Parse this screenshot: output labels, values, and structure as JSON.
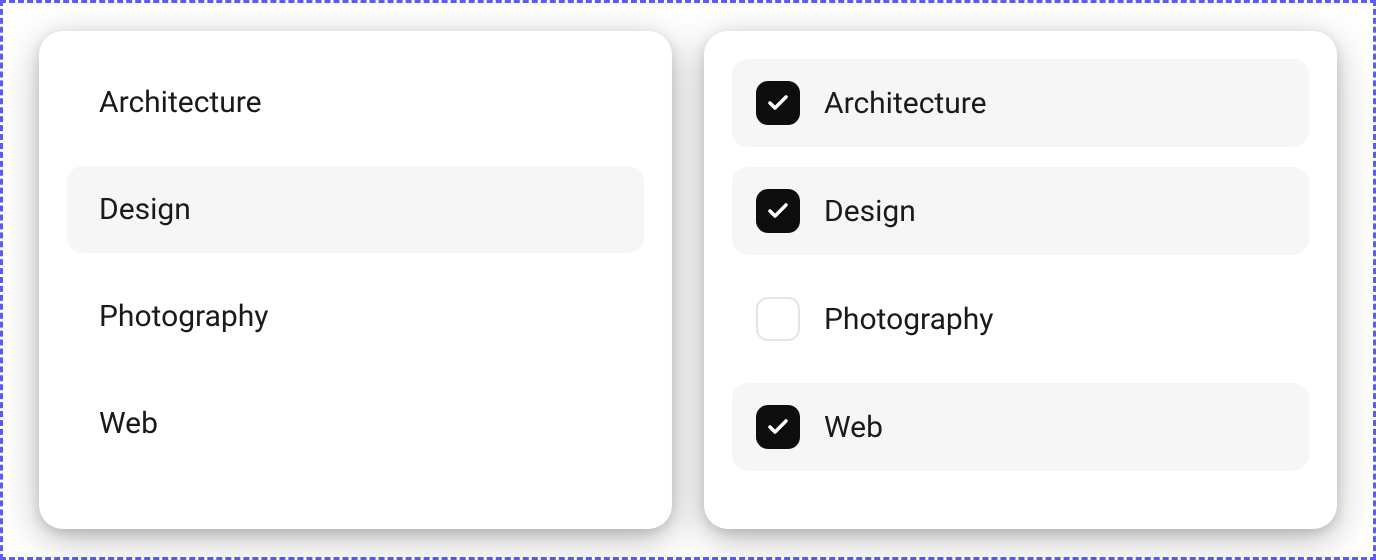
{
  "left_list": {
    "items": [
      {
        "label": "Architecture",
        "highlighted": false
      },
      {
        "label": "Design",
        "highlighted": true
      },
      {
        "label": "Photography",
        "highlighted": false
      },
      {
        "label": "Web",
        "highlighted": false
      }
    ]
  },
  "right_list": {
    "items": [
      {
        "label": "Architecture",
        "checked": true,
        "highlighted": true
      },
      {
        "label": "Design",
        "checked": true,
        "highlighted": true
      },
      {
        "label": "Photography",
        "checked": false,
        "highlighted": false
      },
      {
        "label": "Web",
        "checked": true,
        "highlighted": true
      }
    ]
  }
}
